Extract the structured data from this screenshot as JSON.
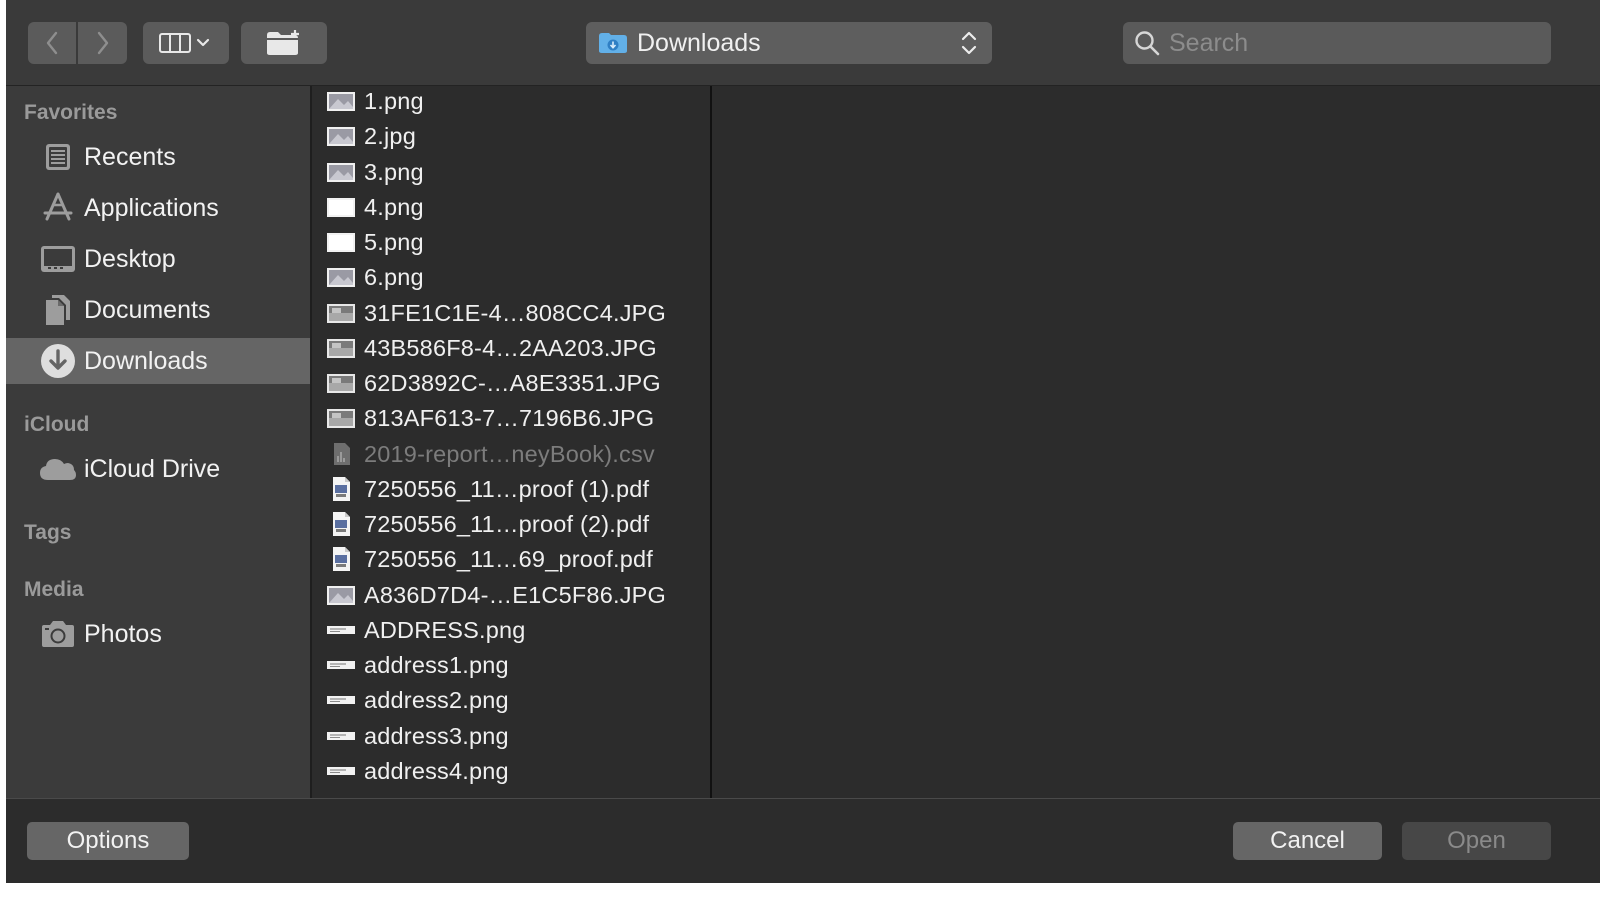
{
  "toolbar": {
    "location_label": "Downloads",
    "search_placeholder": "Search"
  },
  "sidebar": {
    "sections": [
      {
        "title": "Favorites",
        "items": [
          {
            "label": "Recents",
            "icon": "recents-icon"
          },
          {
            "label": "Applications",
            "icon": "applications-icon"
          },
          {
            "label": "Desktop",
            "icon": "desktop-icon"
          },
          {
            "label": "Documents",
            "icon": "documents-icon"
          },
          {
            "label": "Downloads",
            "icon": "downloads-icon",
            "selected": true
          }
        ]
      },
      {
        "title": "iCloud",
        "items": [
          {
            "label": "iCloud Drive",
            "icon": "cloud-icon"
          }
        ]
      },
      {
        "title": "Tags",
        "items": []
      },
      {
        "title": "Media",
        "items": [
          {
            "label": "Photos",
            "icon": "camera-icon"
          }
        ]
      }
    ]
  },
  "files": [
    {
      "name": "1.png",
      "icon": "image-thumbnail-icon"
    },
    {
      "name": "2.jpg",
      "icon": "image-thumbnail-icon"
    },
    {
      "name": "3.png",
      "icon": "image-thumbnail-icon"
    },
    {
      "name": "4.png",
      "icon": "blank-image-icon"
    },
    {
      "name": "5.png",
      "icon": "blank-image-icon"
    },
    {
      "name": "6.png",
      "icon": "image-thumbnail-icon"
    },
    {
      "name": "31FE1C1E-4…808CC4.JPG",
      "icon": "photo-thumbnail-icon"
    },
    {
      "name": "43B586F8-4…2AA203.JPG",
      "icon": "photo-thumbnail-icon"
    },
    {
      "name": "62D3892C-…A8E3351.JPG",
      "icon": "photo-thumbnail-icon"
    },
    {
      "name": "813AF613-7…7196B6.JPG",
      "icon": "photo-thumbnail-icon"
    },
    {
      "name": "2019-report…neyBook).csv",
      "icon": "csv-icon",
      "disabled": true
    },
    {
      "name": "7250556_11…proof (1).pdf",
      "icon": "pdf-icon"
    },
    {
      "name": "7250556_11…proof (2).pdf",
      "icon": "pdf-icon"
    },
    {
      "name": "7250556_11…69_proof.pdf",
      "icon": "pdf-icon"
    },
    {
      "name": "A836D7D4-…E1C5F86.JPG",
      "icon": "image-thumbnail-icon"
    },
    {
      "name": "ADDRESS.png",
      "icon": "strip-image-icon"
    },
    {
      "name": "address1.png",
      "icon": "strip-image-icon"
    },
    {
      "name": "address2.png",
      "icon": "strip-image-icon"
    },
    {
      "name": "address3.png",
      "icon": "strip-image-icon"
    },
    {
      "name": "address4.png",
      "icon": "strip-image-icon"
    }
  ],
  "buttons": {
    "options": "Options",
    "cancel": "Cancel",
    "open": "Open"
  }
}
